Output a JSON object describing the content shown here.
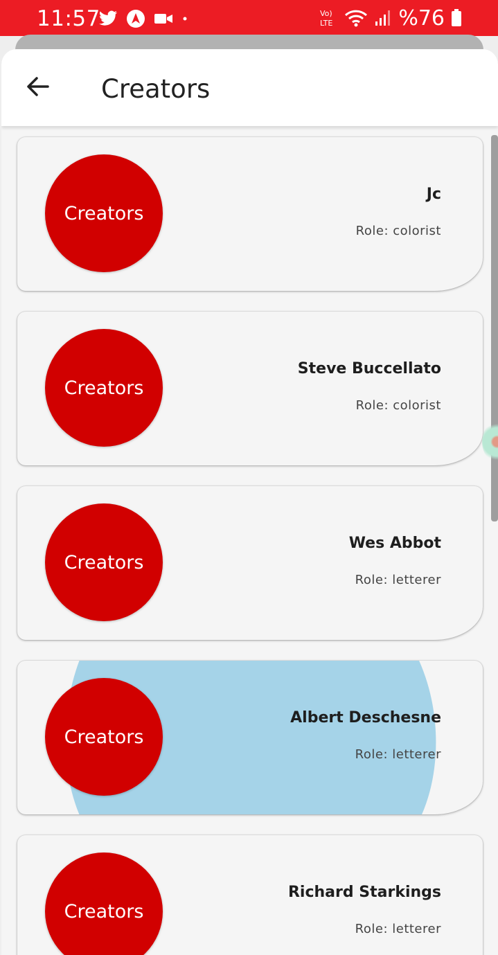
{
  "status_bar": {
    "time": "11:57",
    "battery": "%76",
    "icons_left": [
      "twitter-icon",
      "navigation-icon",
      "video-icon",
      "dot-icon"
    ],
    "icons_right": [
      "volte-icon",
      "wifi-icon",
      "signal-icon",
      "battery-icon"
    ],
    "volte_label_top": "Vo)",
    "volte_label_bottom": "LTE",
    "color": "#ec1c24"
  },
  "app_bar": {
    "title": "Creators",
    "back_icon": "arrow-left-icon"
  },
  "creators": [
    {
      "avatar_label": "Creators",
      "name": "Jc",
      "role": "Role: colorist"
    },
    {
      "avatar_label": "Creators",
      "name": "Steve Buccellato",
      "role": "Role: colorist"
    },
    {
      "avatar_label": "Creators",
      "name": "Wes Abbot",
      "role": "Role: letterer"
    },
    {
      "avatar_label": "Creators",
      "name": "Albert Deschesne",
      "role": "Role: letterer"
    },
    {
      "avatar_label": "Creators",
      "name": "Richard Starkings",
      "role": "Role: letterer"
    }
  ],
  "colors": {
    "avatar": "#d10000",
    "card_background": "#f5f5f5",
    "ripple": "#a5d3e8"
  }
}
